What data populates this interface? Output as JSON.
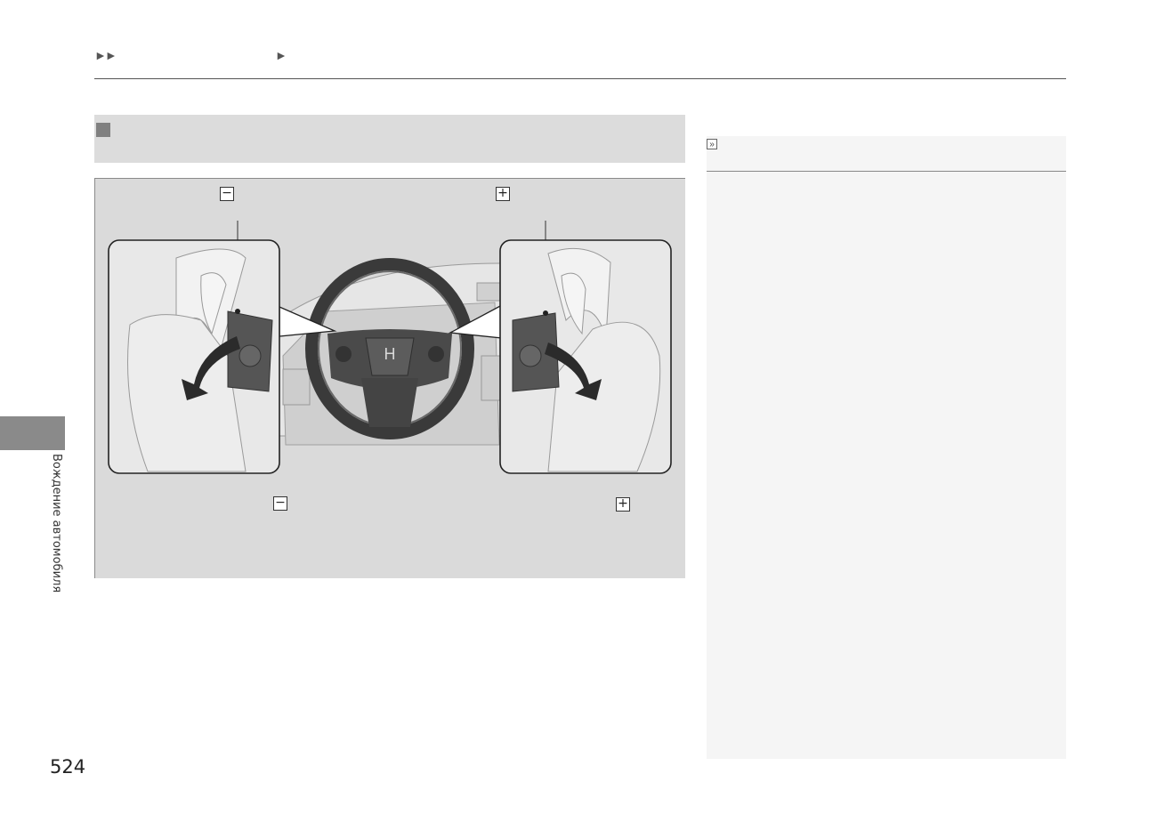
{
  "breadcrumb": {
    "arrows_primary": "►►",
    "arrows_secondary": "►"
  },
  "figure": {
    "label_minus_top": "−",
    "label_plus_top": "+",
    "label_minus_bottom": "−",
    "label_plus_bottom": "+",
    "wheel_logo": "H"
  },
  "note": {
    "icon": "»"
  },
  "side_tab": {
    "label": "Вождение автомобиля"
  },
  "page_number": "524",
  "colors": {
    "panel_gray": "#dadada",
    "tab_gray": "#8a8a8a",
    "arrow_dark": "#2b2b2b"
  }
}
